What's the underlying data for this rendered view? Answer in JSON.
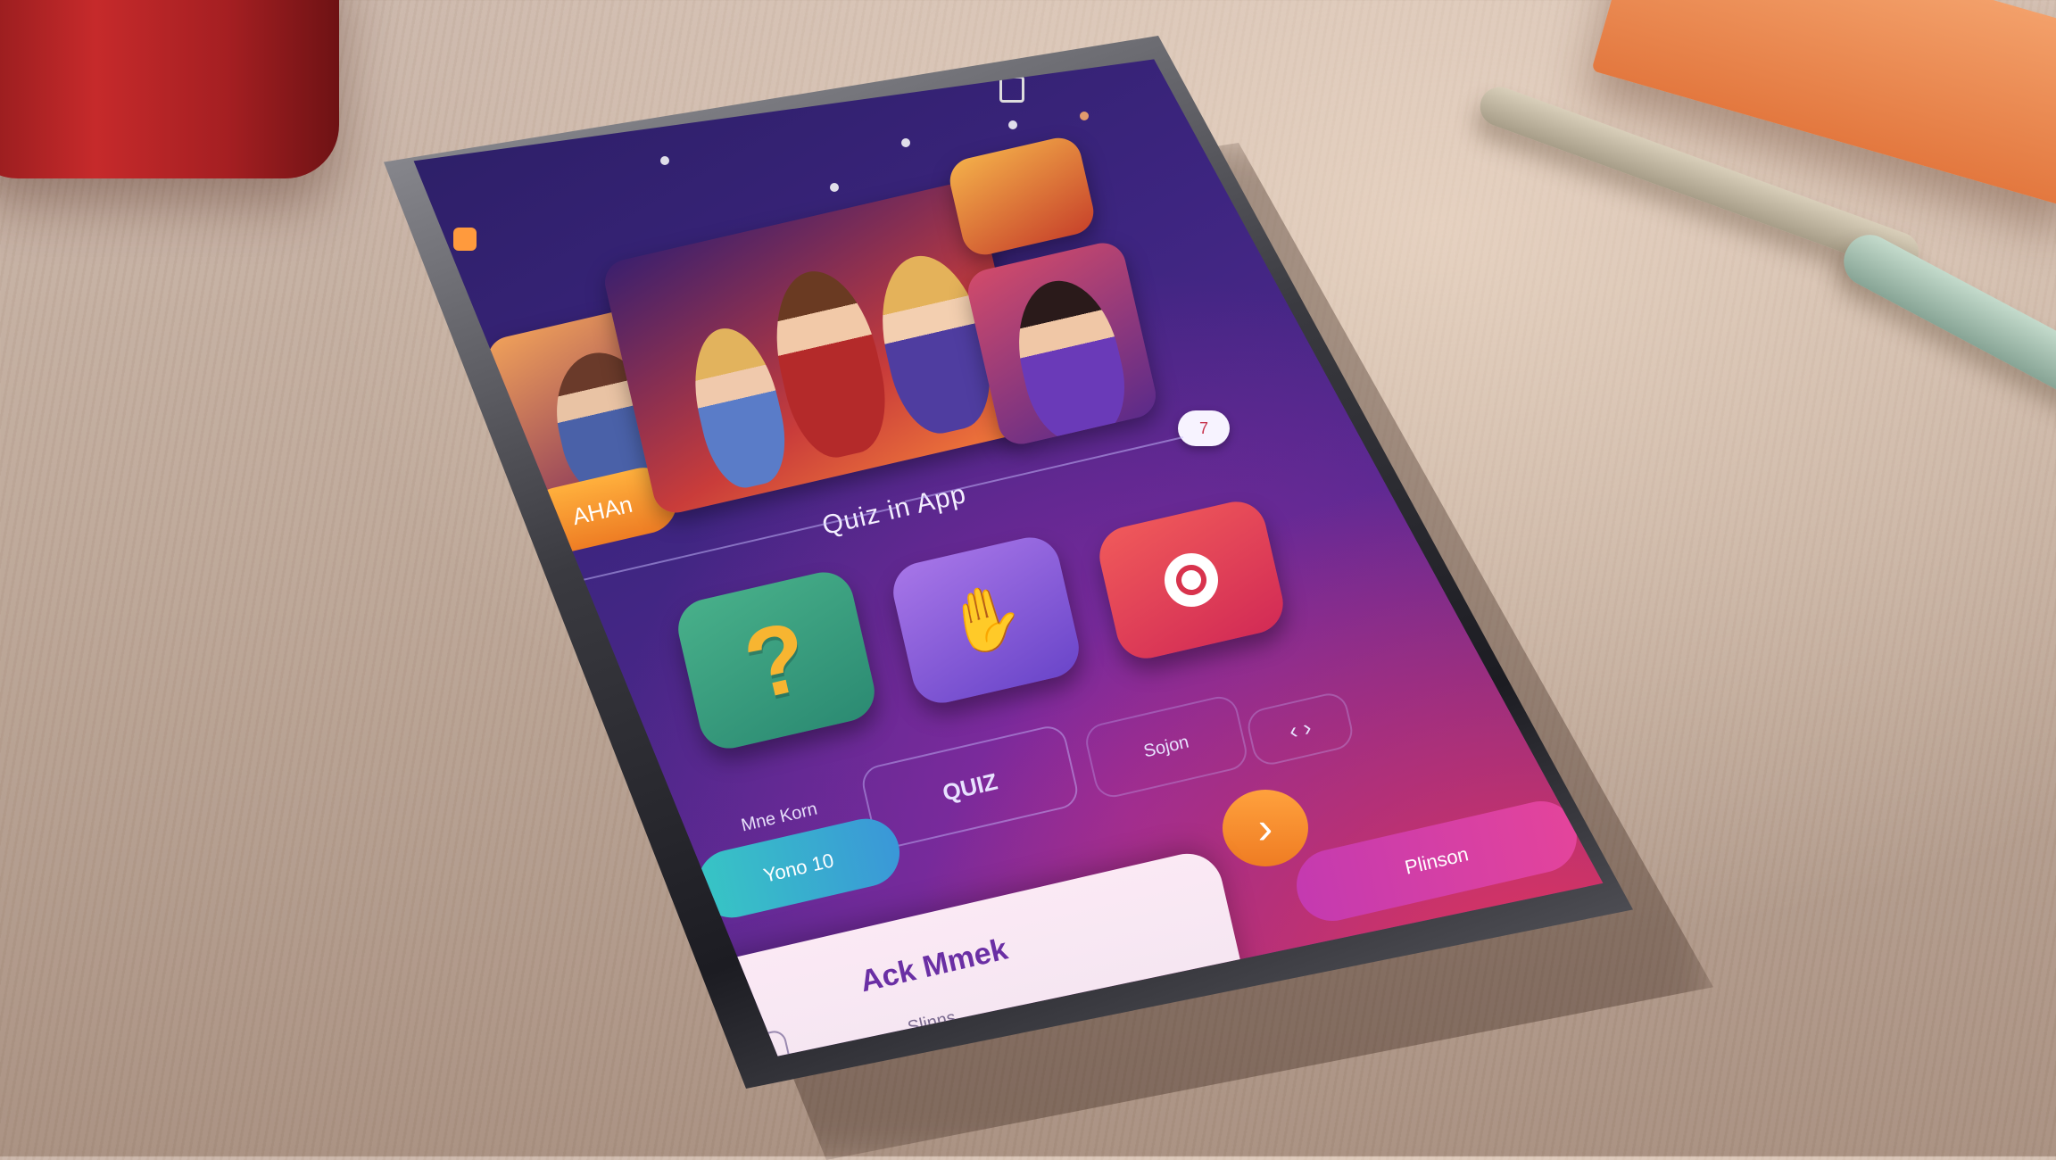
{
  "scene": {
    "props": [
      "red-cup",
      "orange-book",
      "beige-pen",
      "mint-pen"
    ]
  },
  "app": {
    "corner_logo": "logo-icon",
    "status_icon": "battery-icon",
    "avatar_badge": "7",
    "left_photo_badge": "AHAn",
    "title": "Quiz in App",
    "icons": [
      {
        "name": "question-icon",
        "glyph": "?",
        "color": "#2e9d73"
      },
      {
        "name": "hand-icon",
        "glyph": "✋",
        "color": "#8e5bd8"
      },
      {
        "name": "location-icon",
        "glyph": "⬤",
        "color": "#e0314c"
      }
    ],
    "labels": {
      "left": "Mne Korn",
      "center": "QUIZ",
      "right": "Sojon",
      "nav": "‹ ›"
    },
    "buttons": {
      "teal": "Yono 10",
      "next": "›",
      "pink": "Plinson"
    },
    "sheet": {
      "heading": "Ack Mmek",
      "subheading": "Slinns"
    },
    "colors": {
      "accent_orange": "#f1902c",
      "accent_pink": "#d43b9b",
      "accent_teal": "#35b9d6"
    }
  }
}
